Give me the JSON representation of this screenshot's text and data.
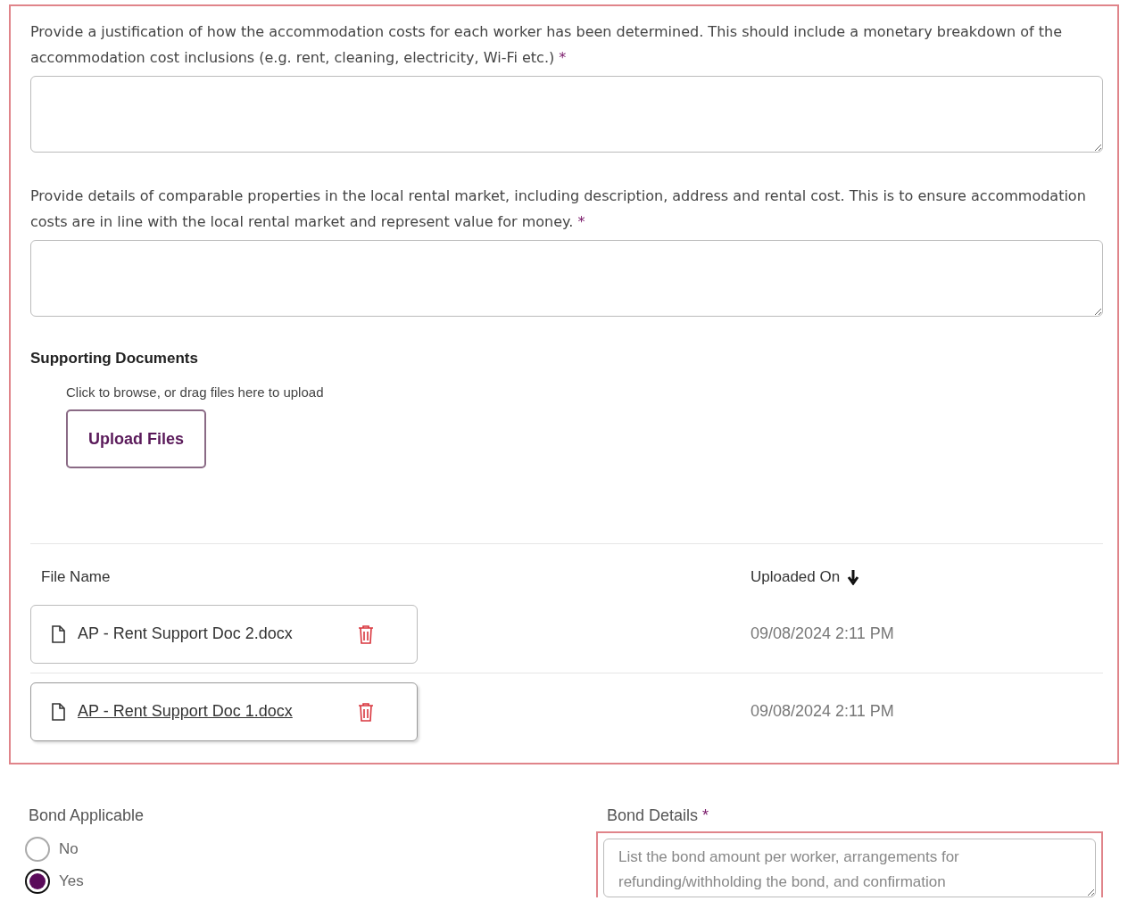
{
  "section": {
    "highlighted": true,
    "questions": [
      {
        "label": "Provide a justification of how the accommodation costs for each worker has been determined. This should include a monetary breakdown of the accommodation cost inclusions (e.g. rent, cleaning, electricity, Wi-Fi etc.)",
        "required_mark": "*"
      },
      {
        "label": "Provide details of comparable properties in the local rental market, including description, address and rental cost. This is to ensure accommodation costs are in line with the local rental market and represent value for money.",
        "required_mark": "*"
      }
    ],
    "supporting_documents": {
      "title": "Supporting Documents",
      "hint": "Click to browse, or drag files here to upload",
      "button": "Upload Files"
    },
    "files_table": {
      "columns": [
        "File Name",
        "Uploaded On"
      ],
      "rows": [
        {
          "file_name": "AP - Rent Support Doc 2.docx",
          "uploaded_on": "09/08/2024 2:11 PM",
          "hovered": false
        },
        {
          "file_name": "AP - Rent Support Doc 1.docx",
          "uploaded_on": "09/08/2024 2:11 PM",
          "hovered": true
        }
      ]
    }
  },
  "bond_applicable": {
    "label": "Bond Applicable",
    "options": [
      {
        "label": "No",
        "selected": false
      },
      {
        "label": "Yes",
        "selected": true
      }
    ]
  },
  "bond_details": {
    "label": "Bond Details",
    "required_mark": "*",
    "highlighted": true,
    "placeholder": "List the bond amount per worker, arrangements for refunding/withholding the bond, and confirmation"
  }
}
